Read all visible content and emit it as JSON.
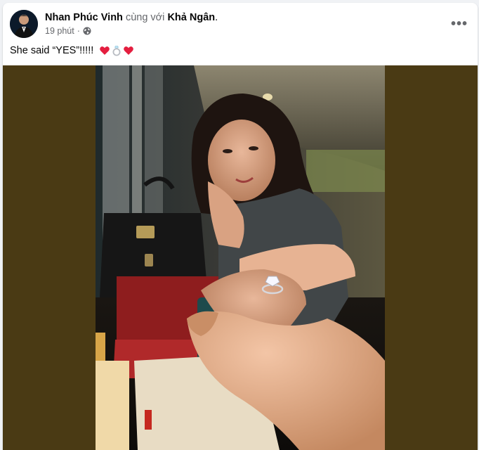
{
  "post": {
    "author": "Nhan Phúc Vinh",
    "with_text": "cùng với",
    "tagged": "Khả Ngân",
    "period": ".",
    "time": "19 phút",
    "separator": "·",
    "privacy_icon": "globe-icon",
    "more_icon": "more-horizontal-icon",
    "caption_text": "She said “YES”!!!!!",
    "caption_emojis": [
      "red-heart-icon",
      "ring-icon",
      "red-heart-icon"
    ]
  },
  "colors": {
    "photo_letterbox": "#4a3a14",
    "text_primary": "#050505",
    "text_secondary": "#65676b",
    "heart": "#e41e3f"
  }
}
